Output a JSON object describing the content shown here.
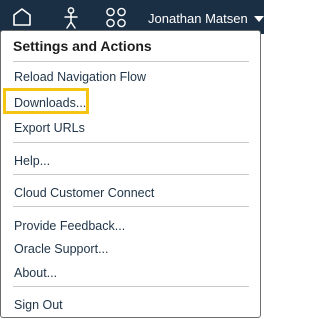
{
  "header": {
    "icons": [
      "home-icon",
      "navigator-icon",
      "apps-icon"
    ],
    "user_name": "Jonathan Matsen",
    "background_color": "#1b2f44"
  },
  "menu": {
    "title": "Settings and Actions",
    "items": [
      {
        "label": "Reload Navigation Flow"
      },
      {
        "label": "Downloads..."
      },
      {
        "label": "Export URLs"
      },
      {
        "label": "Help..."
      },
      {
        "label": "Cloud Customer Connect"
      },
      {
        "label": "Provide Feedback..."
      },
      {
        "label": "Oracle Support..."
      },
      {
        "label": "About..."
      },
      {
        "label": "Sign Out"
      }
    ],
    "highlighted_item": "Downloads...",
    "highlight_color": "#f5c514"
  }
}
